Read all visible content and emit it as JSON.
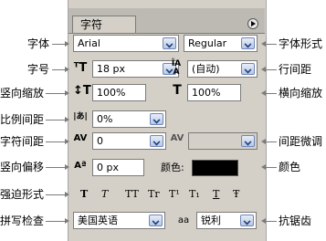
{
  "panel": {
    "tab_label": "字符",
    "font_family": {
      "value": "Arial"
    },
    "font_style": {
      "value": "Regular"
    },
    "font_size": {
      "value": "18 px"
    },
    "leading": {
      "value": "(自动)"
    },
    "vertical_scale": {
      "value": "100%"
    },
    "horizontal_scale": {
      "value": "100%"
    },
    "tsume": {
      "value": "0%"
    },
    "tracking": {
      "value": "0"
    },
    "kerning": {
      "value": ""
    },
    "baseline_shift": {
      "value": "0 px"
    },
    "color_label": "颜色:",
    "color": "#000000",
    "language": {
      "value": "美国英语"
    },
    "antialias": {
      "value": "锐利"
    },
    "style_buttons": [
      "T",
      "T",
      "TT",
      "Tr",
      "T¹",
      "T₁",
      "T",
      "Ŧ"
    ]
  },
  "callouts": {
    "left": [
      "字体",
      "字号",
      "竖向缩放",
      "比例间距",
      "字符间距",
      "竖向偏移",
      "强迫形式",
      "拼写检查"
    ],
    "right": [
      "字体形式",
      "行间距",
      "横向缩放",
      "间距微调",
      "颜色",
      "抗锯齿"
    ]
  },
  "icons": {
    "font_size": "font-size-icon",
    "leading": "leading-icon",
    "vertical_scale": "vertical-scale-icon",
    "horizontal_scale": "horizontal-scale-icon",
    "tsume": "tsume-icon",
    "tracking": "tracking-icon",
    "kerning": "kerning-icon",
    "baseline_shift": "baseline-shift-icon",
    "antialias": "antialias-icon"
  }
}
